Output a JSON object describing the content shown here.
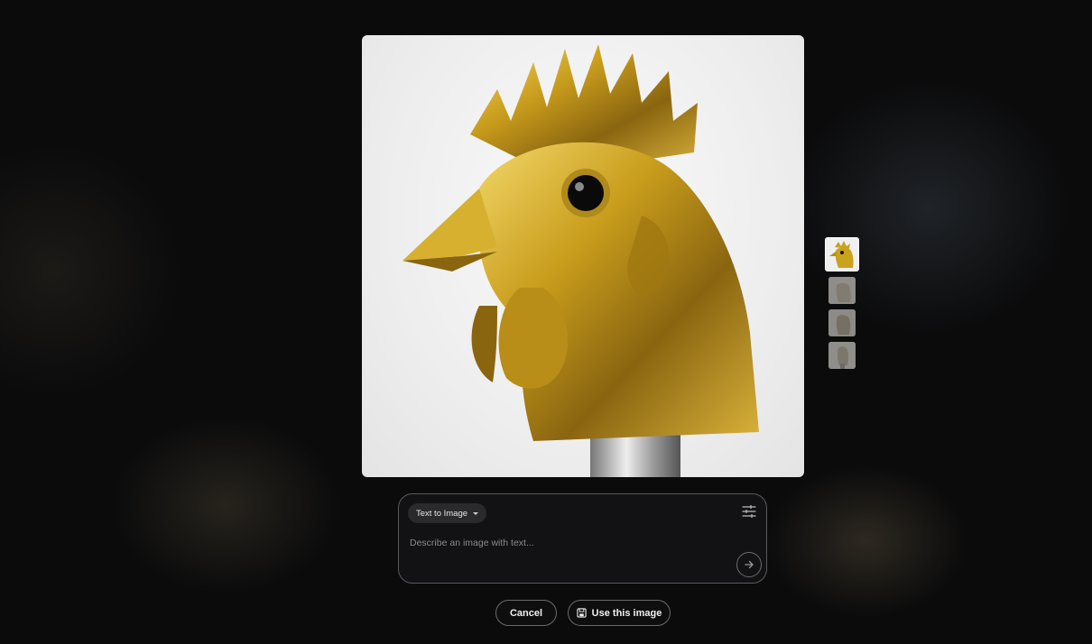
{
  "main_image": {
    "alt": ""
  },
  "thumbnails": [
    {
      "state": "selected"
    },
    {
      "state": "unselected"
    },
    {
      "state": "unselected"
    },
    {
      "state": "unselected"
    }
  ],
  "prompt": {
    "mode_label": "Text to Image",
    "placeholder": "Describe an image with text...",
    "value": "",
    "settings_icon": "sliders-icon",
    "send_icon": "arrow-right-icon"
  },
  "actions": {
    "cancel_label": "Cancel",
    "use_label": "Use this image",
    "use_icon": "save-icon"
  },
  "colors": {
    "background": "#0b0b0c",
    "gold": "#c9a21e",
    "border": "#5a5a5a"
  }
}
